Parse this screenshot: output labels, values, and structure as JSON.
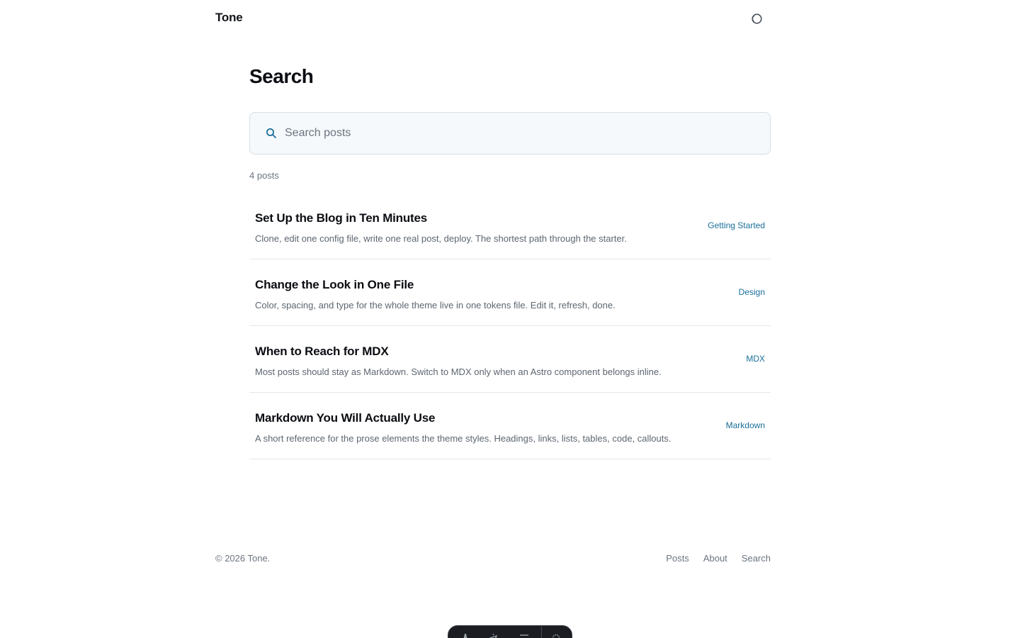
{
  "header": {
    "brand": "Tone",
    "theme_toggle_icon": "half-circle-icon"
  },
  "page": {
    "title": "Search"
  },
  "search": {
    "placeholder": "Search posts",
    "value": "",
    "icon": "search-icon"
  },
  "results_count": "4 posts",
  "results": [
    {
      "title": "Set Up the Blog in Ten Minutes",
      "description": "Clone, edit one config file, write one real post, deploy. The shortest path through the starter.",
      "tag": "Getting Started"
    },
    {
      "title": "Change the Look in One File",
      "description": "Color, spacing, and type for the whole theme live in one tokens file. Edit it, refresh, done.",
      "tag": "Design"
    },
    {
      "title": "When to Reach for MDX",
      "description": "Most posts should stay as Markdown. Switch to MDX only when an Astro component belongs inline.",
      "tag": "MDX"
    },
    {
      "title": "Markdown You Will Actually Use",
      "description": "A short reference for the prose elements the theme styles. Headings, links, lists, tables, code, callouts.",
      "tag": "Markdown"
    }
  ],
  "footer": {
    "copyright": "© 2026 Tone.",
    "nav": [
      "Posts",
      "About",
      "Search"
    ]
  },
  "toolbar": {
    "icons": [
      "astro-logo-icon",
      "cursor-icon",
      "menu-icon",
      "gear-icon"
    ]
  },
  "colors": {
    "accent": "#1a6f9a",
    "text": "#111318",
    "muted": "#6b7480",
    "border": "#d8dde3",
    "search_bg": "#f6f9fb"
  }
}
